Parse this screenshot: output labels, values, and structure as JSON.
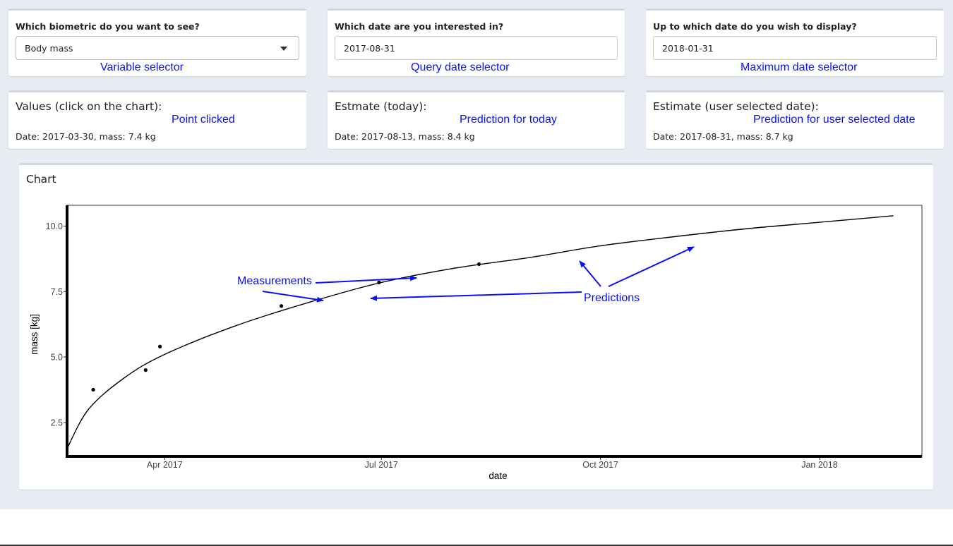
{
  "inputs": {
    "variable": {
      "label": "Which biometric do you want to see?",
      "value": "Body mass",
      "annotation": "Variable selector"
    },
    "query_date": {
      "label": "Which date are you interested in?",
      "value": "2017-08-31",
      "annotation": "Query date selector"
    },
    "max_date": {
      "label": "Up to which date do you wish to display?",
      "value": "2018-01-31",
      "annotation": "Maximum date selector"
    }
  },
  "outputs": {
    "clicked": {
      "title": "Values (click on the chart):",
      "text": "Date: 2017-03-30, mass: 7.4 kg",
      "annotation": "Point clicked"
    },
    "today": {
      "title": "Estmate (today):",
      "text": "Date: 2017-08-13, mass: 8.4 kg",
      "annotation": "Prediction for today"
    },
    "user_date": {
      "title": "Estimate (user selected date):",
      "text": "Date: 2017-08-31, mass: 8.7 kg",
      "annotation": "Prediction for user selected date"
    }
  },
  "chart_panel": {
    "title": "Chart"
  },
  "chart_data": {
    "type": "scatter",
    "xlabel": "date",
    "ylabel": "mass [kg]",
    "xlim": [
      "2017-02-19",
      "2018-02-13"
    ],
    "ylim": [
      1.2,
      10.8
    ],
    "x_ticks": [
      "2017-04-01",
      "2017-07-01",
      "2017-10-01",
      "2018-01-01"
    ],
    "x_tick_labels": [
      "Apr 2017",
      "Jul 2017",
      "Oct 2017",
      "Jan 2018"
    ],
    "y_ticks": [
      2.5,
      5.0,
      7.5,
      10.0
    ],
    "y_tick_labels": [
      "2.5",
      "5.0",
      "7.5",
      "10.0"
    ],
    "grid": true,
    "measurements": [
      {
        "x": "2017-03-02",
        "y": 3.75
      },
      {
        "x": "2017-03-24",
        "y": 4.5
      },
      {
        "x": "2017-03-30",
        "y": 5.4
      },
      {
        "x": "2017-05-20",
        "y": 6.95
      },
      {
        "x": "2017-06-30",
        "y": 7.85
      },
      {
        "x": "2017-08-11",
        "y": 8.55
      }
    ],
    "prediction_curve": [
      {
        "x": "2017-02-19",
        "y": 1.5
      },
      {
        "x": "2017-02-28",
        "y": 3.0
      },
      {
        "x": "2017-03-15",
        "y": 4.2
      },
      {
        "x": "2017-04-01",
        "y": 5.1
      },
      {
        "x": "2017-05-01",
        "y": 6.2
      },
      {
        "x": "2017-06-01",
        "y": 7.1
      },
      {
        "x": "2017-07-01",
        "y": 7.85
      },
      {
        "x": "2017-08-01",
        "y": 8.4
      },
      {
        "x": "2017-09-01",
        "y": 8.8
      },
      {
        "x": "2017-10-01",
        "y": 9.25
      },
      {
        "x": "2017-11-01",
        "y": 9.6
      },
      {
        "x": "2017-12-01",
        "y": 9.9
      },
      {
        "x": "2018-01-01",
        "y": 10.15
      },
      {
        "x": "2018-02-01",
        "y": 10.4
      }
    ],
    "annotations": {
      "measurements_label": "Measurements",
      "predictions_label": "Predictions",
      "color": "#0a10f5"
    }
  }
}
